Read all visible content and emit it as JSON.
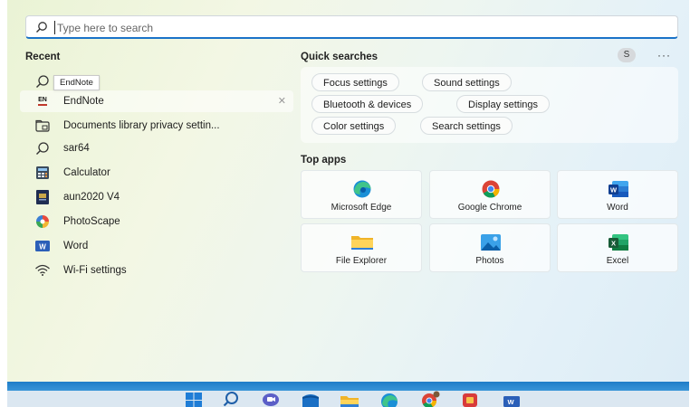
{
  "search": {
    "placeholder": "Type here to search"
  },
  "recent": {
    "heading": "Recent",
    "tooltip": "EndNote",
    "items": [
      {
        "label": "EndNote",
        "icon": "endnote-icon"
      },
      {
        "label": "Documents library privacy settin...",
        "icon": "library-icon"
      },
      {
        "label": "sar64",
        "icon": "search-icon"
      },
      {
        "label": "Calculator",
        "icon": "calculator-icon"
      },
      {
        "label": "aun2020 V4",
        "icon": "document-icon"
      },
      {
        "label": "PhotoScape",
        "icon": "photoscape-icon"
      },
      {
        "label": "Word",
        "icon": "word-icon"
      },
      {
        "label": "Wi-Fi settings",
        "icon": "wifi-icon"
      }
    ],
    "close_glyph": "✕",
    "endnote_badge": "EN"
  },
  "quick_searches": {
    "heading": "Quick searches",
    "chips": [
      "Focus settings",
      "Sound settings",
      "Bluetooth & devices",
      "Display settings",
      "Color settings",
      "Search settings"
    ]
  },
  "account": {
    "initial": "S",
    "more": "···"
  },
  "top_apps": {
    "heading": "Top apps",
    "apps": [
      {
        "label": "Microsoft Edge",
        "icon": "edge-icon"
      },
      {
        "label": "Google Chrome",
        "icon": "chrome-icon"
      },
      {
        "label": "Word",
        "icon": "word-icon"
      },
      {
        "label": "File Explorer",
        "icon": "folder-icon"
      },
      {
        "label": "Photos",
        "icon": "photos-icon"
      },
      {
        "label": "Excel",
        "icon": "excel-icon"
      }
    ]
  },
  "taskbar": {
    "icons": [
      "windows-start-icon",
      "search-icon",
      "teams-chat-icon",
      "store-icon",
      "file-explorer-icon",
      "edge-icon",
      "chrome-icon",
      "app-icon",
      "word-icon"
    ]
  },
  "colors": {
    "accent": "#1a73c8",
    "taskbar_line": "#1f7dc8"
  }
}
